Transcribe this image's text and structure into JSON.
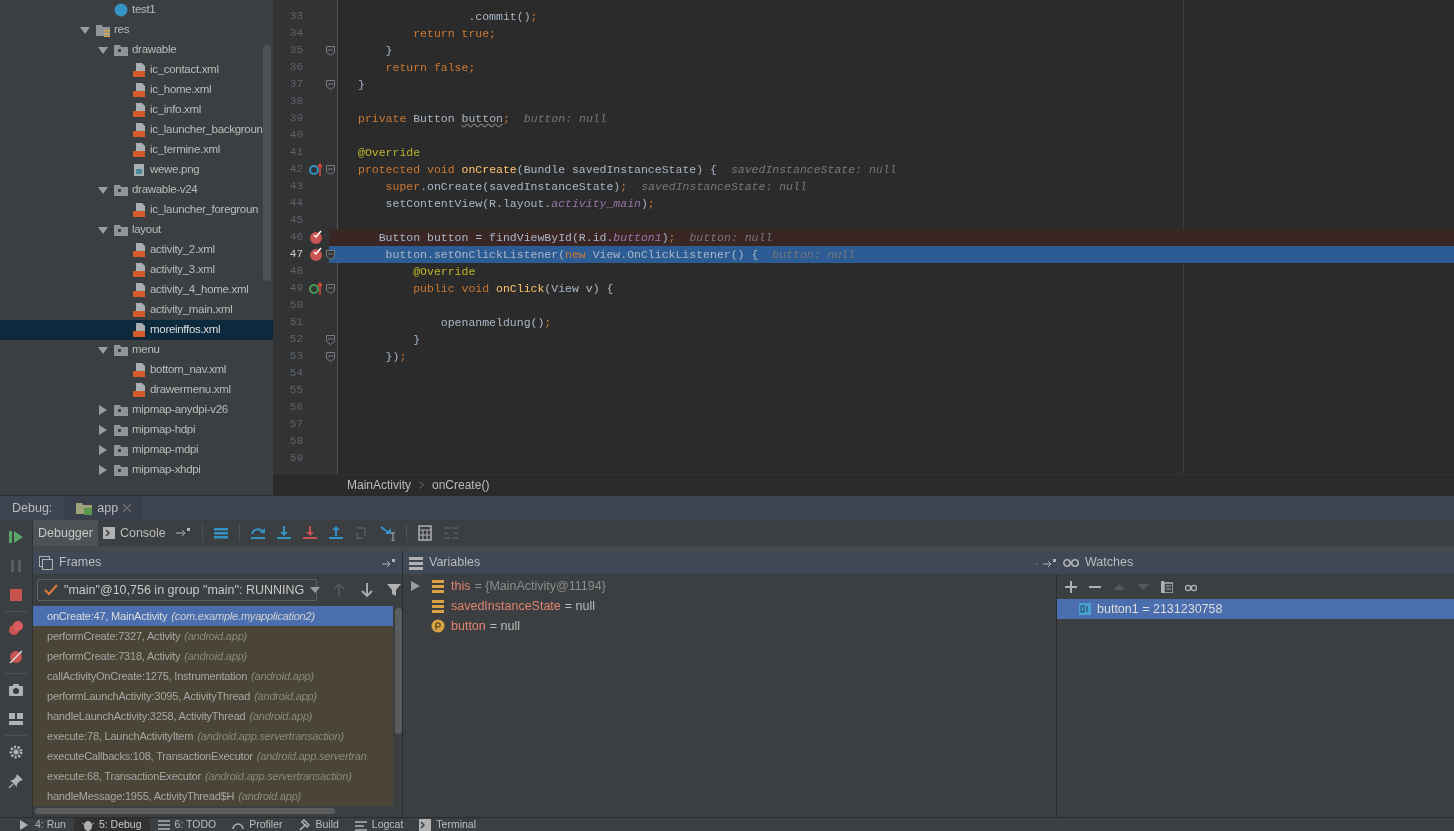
{
  "project_tree": [
    {
      "children": [
        {
          "label": "test1",
          "kind": "class",
          "selected": false
        }
      ]
    },
    {
      "label": "res",
      "kind": "res-folder",
      "expanded": true,
      "selected": false,
      "children": [
        {
          "label": "drawable",
          "kind": "folder",
          "expanded": true,
          "selected": false,
          "children": [
            {
              "label": "ic_contact.xml",
              "kind": "xml",
              "selected": false
            },
            {
              "label": "ic_home.xml",
              "kind": "xml",
              "selected": false
            },
            {
              "label": "ic_info.xml",
              "kind": "xml",
              "selected": false
            },
            {
              "label": "ic_launcher_backgroun",
              "kind": "xml",
              "selected": false
            },
            {
              "label": "ic_termine.xml",
              "kind": "xml",
              "selected": false
            },
            {
              "label": "wewe.png",
              "kind": "image",
              "selected": false
            }
          ]
        },
        {
          "label": "drawable-v24",
          "kind": "folder",
          "expanded": true,
          "selected": false,
          "children": [
            {
              "label": "ic_launcher_foregroun",
              "kind": "xml",
              "selected": false
            }
          ]
        },
        {
          "label": "layout",
          "kind": "folder",
          "expanded": true,
          "selected": false,
          "children": [
            {
              "label": "activity_2.xml",
              "kind": "xml",
              "selected": false
            },
            {
              "label": "activity_3.xml",
              "kind": "xml",
              "selected": false
            },
            {
              "label": "activity_4_home.xml",
              "kind": "xml",
              "selected": false
            },
            {
              "label": "activity_main.xml",
              "kind": "xml",
              "selected": false
            },
            {
              "label": "moreinffos.xml",
              "kind": "xml",
              "selected": true
            }
          ]
        },
        {
          "label": "menu",
          "kind": "folder",
          "expanded": true,
          "selected": false,
          "children": [
            {
              "label": "bottom_nav.xml",
              "kind": "xml",
              "selected": false
            },
            {
              "label": "drawermenu.xml",
              "kind": "xml",
              "selected": false
            }
          ]
        },
        {
          "label": "mipmap-anydpi-v26",
          "kind": "folder",
          "expanded": false,
          "selected": false
        },
        {
          "label": "mipmap-hdpi",
          "kind": "folder",
          "expanded": false,
          "selected": false
        },
        {
          "label": "mipmap-mdpi",
          "kind": "folder",
          "expanded": false,
          "selected": false
        },
        {
          "label": "mipmap-xhdpi",
          "kind": "folder",
          "expanded": false,
          "selected": false
        }
      ]
    }
  ],
  "editor": {
    "lines": [
      {
        "number": "33",
        "fold": false,
        "tokens": [
          {
            "text": "                .commit()",
            "kind": "plain"
          },
          {
            "text": ";",
            "kind": "keyword"
          }
        ]
      },
      {
        "number": "34",
        "fold": false,
        "tokens": [
          {
            "text": "        return true;",
            "kind": "keyword"
          }
        ]
      },
      {
        "number": "35",
        "fold": true,
        "tokens": [
          {
            "text": "    }",
            "kind": "plain"
          }
        ]
      },
      {
        "number": "36",
        "fold": false,
        "tokens": [
          {
            "text": "    return false;",
            "kind": "keyword"
          }
        ]
      },
      {
        "number": "37",
        "fold": true,
        "tokens": [
          {
            "text": "}",
            "kind": "plain"
          }
        ]
      },
      {
        "number": "38",
        "fold": false
      },
      {
        "number": "39",
        "fold": false,
        "tokens": [
          {
            "text": "private ",
            "kind": "keyword"
          },
          {
            "text": "Button ",
            "kind": "plain"
          },
          {
            "text": "button",
            "kind": "unused"
          },
          {
            "text": ";",
            "kind": "keyword"
          }
        ],
        "hint": "button: null"
      },
      {
        "number": "40",
        "fold": false
      },
      {
        "number": "41",
        "fold": false,
        "tokens": [
          {
            "text": "@Override",
            "kind": "annotation"
          }
        ]
      },
      {
        "number": "42",
        "fold": true,
        "gutter_icon": {
          "kind": "overrides"
        },
        "tokens": [
          {
            "text": "protected void ",
            "kind": "keyword"
          },
          {
            "text": "onCreate",
            "kind": "method"
          },
          {
            "text": "(Bundle savedInstanceState) {",
            "kind": "plain"
          }
        ],
        "hint": "savedInstanceState: null"
      },
      {
        "number": "43",
        "fold": false,
        "tokens": [
          {
            "text": "    super",
            "kind": "keyword"
          },
          {
            "text": ".onCreate(savedInstanceState)",
            "kind": "plain"
          },
          {
            "text": ";",
            "kind": "keyword"
          }
        ],
        "hint": "savedInstanceState: null"
      },
      {
        "number": "44",
        "fold": false,
        "tokens": [
          {
            "text": "    setContentView(R.layout.",
            "kind": "plain"
          },
          {
            "text": "activity_main",
            "kind": "field"
          },
          {
            "text": ")",
            "kind": "plain"
          },
          {
            "text": ";",
            "kind": "keyword"
          }
        ]
      },
      {
        "number": "45",
        "fold": false
      },
      {
        "number": "46",
        "fold": false,
        "breakpoint": true,
        "execution_point": false,
        "tokens": [
          {
            "text": "   Button button = findViewById(R.id.",
            "kind": "plain"
          },
          {
            "text": "button1",
            "kind": "field"
          },
          {
            "text": ")",
            "kind": "plain"
          },
          {
            "text": ";",
            "kind": "keyword"
          }
        ],
        "hint": "button: null"
      },
      {
        "number": "47",
        "fold": true,
        "breakpoint": true,
        "execution_point": true,
        "tokens": [
          {
            "text": "    button.setOnClickListener(",
            "kind": "plain"
          },
          {
            "text": "new ",
            "kind": "keyword"
          },
          {
            "text": "View.OnClickListener() {",
            "kind": "plain"
          }
        ],
        "hint": "button: null"
      },
      {
        "number": "48",
        "fold": false,
        "tokens": [
          {
            "text": "        @Override",
            "kind": "annotation"
          }
        ]
      },
      {
        "number": "49",
        "fold": true,
        "gutter_icon": {
          "kind": "implements"
        },
        "tokens": [
          {
            "text": "        public void ",
            "kind": "keyword"
          },
          {
            "text": "onClick",
            "kind": "method"
          },
          {
            "text": "(View v) {",
            "kind": "plain"
          }
        ]
      },
      {
        "number": "50",
        "fold": false
      },
      {
        "number": "51",
        "fold": false,
        "tokens": [
          {
            "text": "            openanmeldung()",
            "kind": "plain"
          },
          {
            "text": ";",
            "kind": "keyword"
          }
        ]
      },
      {
        "number": "52",
        "fold": true,
        "tokens": [
          {
            "text": "        }",
            "kind": "plain"
          }
        ]
      },
      {
        "number": "53",
        "fold": true,
        "tokens": [
          {
            "text": "    })",
            "kind": "plain"
          },
          {
            "text": ";",
            "kind": "keyword"
          }
        ]
      },
      {
        "number": "54",
        "fold": false
      },
      {
        "number": "55",
        "fold": false
      },
      {
        "number": "56",
        "fold": false
      },
      {
        "number": "57",
        "fold": false
      },
      {
        "number": "58",
        "fold": false
      },
      {
        "number": "59",
        "fold": false
      }
    ],
    "breadcrumbs": [
      "MainActivity",
      "onCreate()"
    ]
  },
  "debug": {
    "label": "Debug:",
    "session_tab": "app",
    "tabs": [
      {
        "label": "Debugger",
        "selected": true
      },
      {
        "label": "Console",
        "selected": false
      }
    ],
    "frames": {
      "title": "Frames",
      "thread": "\"main\"@10,756 in group \"main\": RUNNING",
      "items": [
        {
          "method": "onCreate:47, MainActivity",
          "package": "(com.example.myapplication2)",
          "selected": true,
          "library": false
        },
        {
          "method": "performCreate:7327, Activity",
          "package": "(android.app)",
          "selected": false,
          "library": true
        },
        {
          "method": "performCreate:7318, Activity",
          "package": "(android.app)",
          "selected": false,
          "library": true
        },
        {
          "method": "callActivityOnCreate:1275, Instrumentation",
          "package": "(android.app)",
          "selected": false,
          "library": true
        },
        {
          "method": "performLaunchActivity:3095, ActivityThread",
          "package": "(android.app)",
          "selected": false,
          "library": true
        },
        {
          "method": "handleLaunchActivity:3258, ActivityThread",
          "package": "(android.app)",
          "selected": false,
          "library": true
        },
        {
          "method": "execute:78, LaunchActivityItem",
          "package": "(android.app.servertransaction)",
          "selected": false,
          "library": true
        },
        {
          "method": "executeCallbacks:108, TransactionExecutor",
          "package": "(android.app.servertran",
          "selected": false,
          "library": true
        },
        {
          "method": "execute:68, TransactionExecutor",
          "package": "(android.app.servertransaction)",
          "selected": false,
          "library": true
        },
        {
          "method": "handleMessage:1955, ActivityThread$H",
          "package": "(android.app)",
          "selected": false,
          "library": true
        }
      ]
    },
    "variables": {
      "title": "Variables",
      "items": [
        {
          "kind": "field",
          "name": "this",
          "value": "= {MainActivity@11194}",
          "expandable": true
        },
        {
          "kind": "field",
          "name": "savedInstanceState",
          "value": "= null",
          "expandable": false
        },
        {
          "kind": "param",
          "name": "button",
          "value": "= null",
          "expandable": false
        }
      ]
    },
    "watches": {
      "title": "Watches",
      "items": [
        {
          "expression": "button1 = 2131230758",
          "selected": true
        }
      ]
    }
  },
  "bottom_tabs": [
    {
      "label": "4: Run",
      "kind": "run",
      "selected": false
    },
    {
      "label": "5: Debug",
      "kind": "debug",
      "selected": true
    },
    {
      "label": "6: TODO",
      "kind": "todo",
      "selected": false
    },
    {
      "label": "Profiler",
      "kind": "profiler",
      "selected": false
    },
    {
      "label": "Build",
      "kind": "build",
      "selected": false
    },
    {
      "label": "Logcat",
      "kind": "logcat",
      "selected": false
    },
    {
      "label": "Terminal",
      "kind": "terminal",
      "selected": false
    }
  ]
}
